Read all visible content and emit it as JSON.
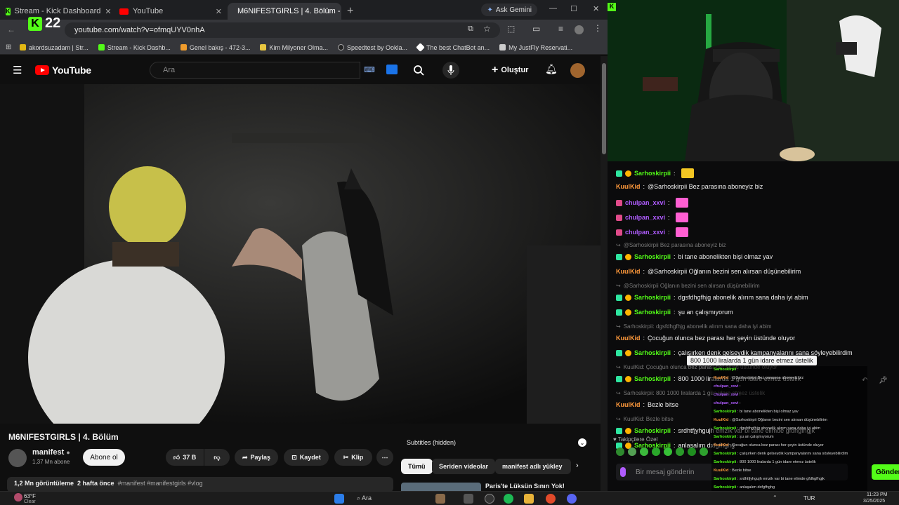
{
  "browser": {
    "tabs": [
      {
        "label": "Stream - Kick Dashboard",
        "active": false
      },
      {
        "label": "YouTube",
        "active": false
      },
      {
        "label": "M6NIFESTGIRLS | 4. Bölüm - You",
        "active": true
      }
    ],
    "gemini_label": "Ask Gemini",
    "url": "youtube.com/watch?v=ofmqUYV0nhA",
    "kick_overlay_count": "22",
    "bookmarks": [
      "akordsuzadam | Str...",
      "Stream - Kick Dashb...",
      "Genel bakış - 472-3...",
      "Kim Milyoner Olma...",
      "Speedtest by Ookla...",
      "The best ChatBot an...",
      "My JustFly Reservati..."
    ]
  },
  "youtube": {
    "logo": "YouTube",
    "search_placeholder": "Ara",
    "create_label": "Oluştur",
    "video_title": "M6NIFESTGIRLS | 4. Bölüm",
    "channel": "manifest",
    "subscribers": "1,37 Mn abone",
    "subscribe_label": "Abone ol",
    "likes": "37 B",
    "share_label": "Paylaş",
    "save_label": "Kaydet",
    "clip_label": "Klip",
    "views": "1,2 Mn görüntüleme",
    "age": "2 hafta önce",
    "tags": "#manifest #manifestgirls #vlog",
    "subtitles": "Subtitles (hidden)",
    "chips": [
      "Tümü",
      "Seriden videolar",
      "manifest adlı yükley"
    ],
    "next_video_title": "Paris'te Lüksün Sınırı Yok!"
  },
  "chat": {
    "lines": [
      {
        "user": "Sarhoskirpii",
        "text": "",
        "color": "g"
      },
      {
        "user": "KuulKid",
        "text": "@Sarhoskirpii Bez parasına aboneyiz biz",
        "color": "o"
      },
      {
        "user": "chulpan_xxvi",
        "text": "",
        "color": "p"
      },
      {
        "user": "chulpan_xxvi",
        "text": "",
        "color": "p"
      },
      {
        "user": "chulpan_xxvi",
        "text": "",
        "color": "p"
      },
      {
        "reply": "@Sarhoskirpii Bez parasına aboneyiz biz"
      },
      {
        "user": "Sarhoskirpii",
        "text": "bi tane abonelikten bişi olmaz yav",
        "color": "g"
      },
      {
        "user": "KuulKid",
        "text": "@Sarhoskirpii Oğlanın bezini sen alırsan düşünebilirim",
        "color": "o"
      },
      {
        "reply": "@Sarhoskirpii Oğlanın bezini sen alırsan düşünebilirim"
      },
      {
        "user": "Sarhoskirpii",
        "text": "dgsfdhgfhjg abonelik alırım sana daha iyi abim",
        "color": "g"
      },
      {
        "user": "Sarhoskirpii",
        "text": "şu an çalışmıyorum",
        "color": "g"
      },
      {
        "reply": "Sarhoskirpii: dgsfdhgfhjg abonelik alırım sana daha iyi abim"
      },
      {
        "user": "KuulKid",
        "text": "Çocuğun olunca bez parası her şeyin üstünde oluyor",
        "color": "o"
      },
      {
        "user": "Sarhoskirpii",
        "text": "çalışırken denk gelseydik kampanyalarını sana söyleyebilirdim",
        "color": "g"
      },
      {
        "reply": "KuulKid: Çocuğun olunca bez parası her şeyin üstünde oluyor"
      },
      {
        "user": "Sarhoskirpii",
        "text": "800 1000 liralarda 1 gün idare etmez üstelik",
        "color": "g"
      },
      {
        "reply": "Sarhoskirpii: 800 1000 liralarda 1 gün idare etmez üstelik"
      },
      {
        "user": "KuulKid",
        "text": "Bezle bitse",
        "color": "o"
      },
      {
        "reply": "KuulKid: Bezle bitse"
      },
      {
        "user": "Sarhoskirpii",
        "text": "srdhtfjyhgujh emzik var bi tane elimde gfdhgfhgjk",
        "color": "g"
      },
      {
        "user": "Sarhoskirpii",
        "text": "anlaşalım dxfgfhghg",
        "color": "g"
      }
    ],
    "tooltip": "800 1000 liralarda 1 gün idare etmez üstelik",
    "followers_only": "Takipçilere Özel",
    "message_placeholder": "Bir mesaj gönderin",
    "send_label": "Gönder"
  },
  "taskbar": {
    "weather_temp": "63°F",
    "weather_text": "Clear",
    "search": "Ara",
    "lang": "TUR",
    "time": "11:23 PM",
    "date": "3/25/2025"
  }
}
